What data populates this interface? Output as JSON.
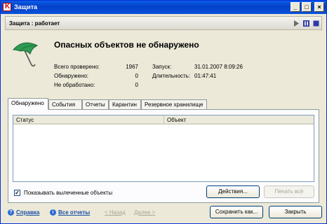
{
  "window": {
    "title": "Защита"
  },
  "band": {
    "status": "Защита : работает"
  },
  "header": {
    "headline": "Опасных объектов не обнаружено"
  },
  "stats": {
    "checked_label": "Всего проверено:",
    "checked_value": "1967",
    "detected_label": "Обнаружено:",
    "detected_value": "0",
    "untreated_label": "Не обработано:",
    "untreated_value": "0",
    "start_label": "Запуск:",
    "start_value": "31.01.2007 8:09:26",
    "duration_label": "Длительность:",
    "duration_value": "01:47:41"
  },
  "tabs": [
    {
      "label": "Обнаружено"
    },
    {
      "label": "События"
    },
    {
      "label": "Отчеты"
    },
    {
      "label": "Карантин"
    },
    {
      "label": "Резервное хранилище"
    }
  ],
  "table": {
    "columns": [
      "Статус",
      "Объект"
    ]
  },
  "panel": {
    "show_cured_label": "Показывать вылеченные объекты",
    "show_cured_checked": true,
    "actions_label": "Действия...",
    "print_all_label": "Печать всё"
  },
  "footer": {
    "help_label": "Справка",
    "all_reports_label": "Все отчеты",
    "back_label": "< Назад",
    "next_label": "Далее >",
    "save_as_label": "Сохранить как...",
    "close_label": "Закрыть"
  },
  "colors": {
    "title_bar": "#0a5ee6",
    "accent_green": "#2e9a52",
    "link": "#1a4fa8"
  },
  "icons": {
    "app": "kaspersky-k-icon",
    "header": "green-umbrella-icon",
    "controls": [
      "play-icon",
      "pause-icon",
      "stop-icon"
    ]
  }
}
